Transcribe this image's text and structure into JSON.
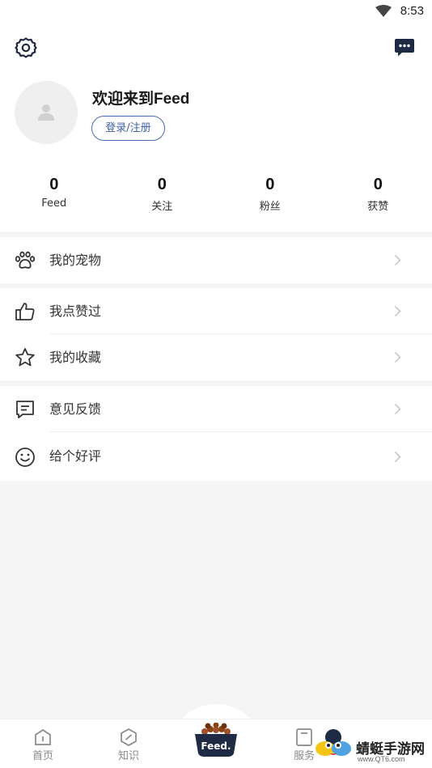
{
  "status_bar": {
    "time": "8:53"
  },
  "header": {
    "settings_icon": "gear-icon",
    "message_icon": "chat-bubble-icon"
  },
  "profile": {
    "welcome": "欢迎来到Feed",
    "login_label": "登录/注册"
  },
  "stats": [
    {
      "value": "0",
      "label": "Feed"
    },
    {
      "value": "0",
      "label": "关注"
    },
    {
      "value": "0",
      "label": "粉丝"
    },
    {
      "value": "0",
      "label": "获赞"
    }
  ],
  "menu": {
    "pets": "我的宠物",
    "liked": "我点赞过",
    "favorites": "我的收藏",
    "feedback": "意见反馈",
    "rate": "给个好评"
  },
  "tabbar": {
    "home": "首页",
    "knowledge": "知识",
    "center": "Feed.",
    "service": "服务"
  },
  "watermark": {
    "title": "蜻蜓手游网",
    "url": "www.QT6.com"
  },
  "colors": {
    "accent": "#3e5fa8",
    "background": "#f5f5f5",
    "icon_dark": "#1f2a44"
  }
}
